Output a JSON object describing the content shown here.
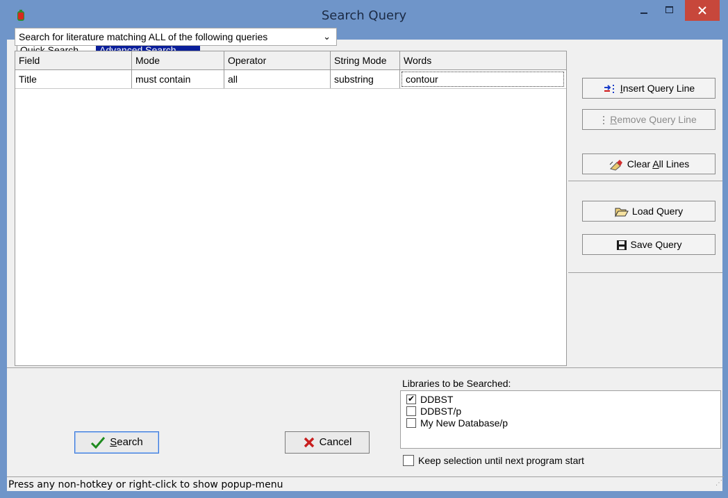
{
  "window": {
    "title": "Search Query"
  },
  "tabs": [
    {
      "label": "Quick Search",
      "active": false
    },
    {
      "label": "Advanced Search",
      "active": true
    }
  ],
  "match_mode": {
    "selected": "Search for literature matching ALL of the following queries"
  },
  "grid": {
    "columns": [
      "Field",
      "Mode",
      "Operator",
      "String Mode",
      "Words"
    ],
    "rows": [
      [
        "Title",
        "must contain",
        "all",
        "substring",
        "contour"
      ]
    ]
  },
  "side_buttons": {
    "insert": {
      "pre": "",
      "hot": "I",
      "post": "nsert Query Line"
    },
    "remove": {
      "pre": "",
      "hot": "R",
      "post": "emove Query Line",
      "disabled": true
    },
    "clear": {
      "pre": "Clear ",
      "hot": "A",
      "post": "ll Lines"
    },
    "load": "Load Query",
    "save": "Save Query"
  },
  "actions": {
    "search": {
      "hot": "S",
      "post": "earch"
    },
    "cancel": "Cancel"
  },
  "libraries": {
    "label": "Libraries to be Searched:",
    "items": [
      {
        "name": "DDBST",
        "checked": true
      },
      {
        "name": "DDBST/p",
        "checked": false
      },
      {
        "name": "My New Database/p",
        "checked": false
      }
    ]
  },
  "keep_selection": {
    "label": "Keep selection until next program start",
    "checked": false
  },
  "status": {
    "text": "Press any non-hotkey or right-click to show popup-menu"
  },
  "colors": {
    "titlebar": "#6f95c9",
    "close": "#c7473b",
    "tab_active": "#0a1e9a"
  }
}
